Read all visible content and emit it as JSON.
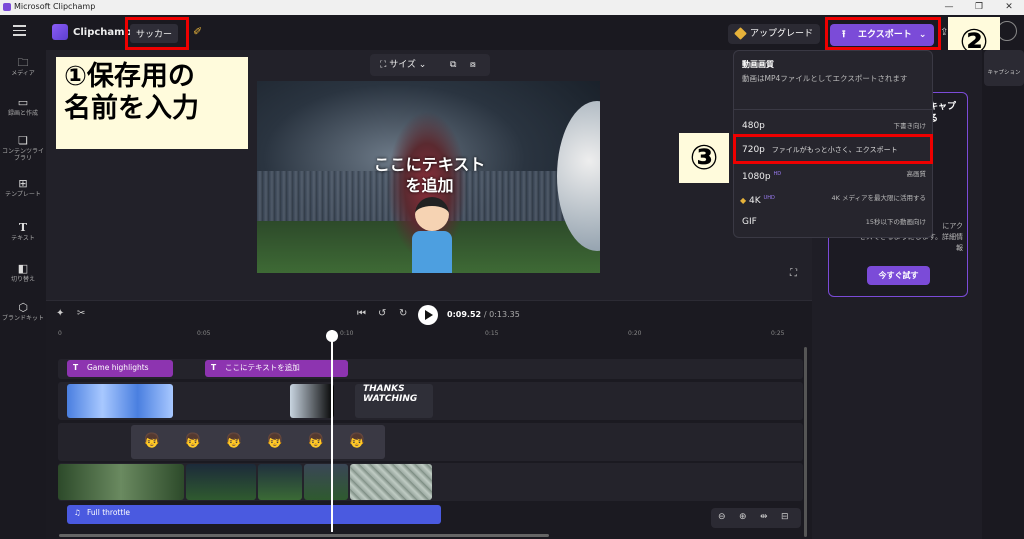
{
  "window": {
    "title": "Microsoft Clipchamp",
    "minimize": "—",
    "maximize": "❐",
    "close": "✕"
  },
  "header": {
    "brand": "Clipchamp",
    "project_name": "サッカー",
    "upgrade_label": "アップグレード",
    "export_label": "エクスポート",
    "export_chevron": "⌄"
  },
  "rail": {
    "items": [
      {
        "icon": "🗀",
        "label": "メディア"
      },
      {
        "icon": "▭",
        "label": "録画と作成"
      },
      {
        "icon": "❏",
        "label": "コンテンツライブラリ"
      },
      {
        "icon": "⊞",
        "label": "テンプレート"
      },
      {
        "icon": "T",
        "label": "テキスト"
      },
      {
        "icon": "◧",
        "label": "切り替え"
      },
      {
        "icon": "⬡",
        "label": "ブランドキット"
      }
    ]
  },
  "preview": {
    "size_label": "サイズ",
    "overlay_text_line1": "ここにテキスト",
    "overlay_text_line2": "を追加"
  },
  "annotations": {
    "note_line1": "①保存用の",
    "note_line2": "名前を入力",
    "step2": "②",
    "step3": "③"
  },
  "export_menu": {
    "heading": "動画画質",
    "description": "動画はMP4ファイルとしてエクスポートされます",
    "options": [
      {
        "label": "480p",
        "desc": "下書き向け",
        "badge": ""
      },
      {
        "label": "720p",
        "desc": "ファイルがもっと小さく、エクスポート",
        "badge": ""
      },
      {
        "label": "1080p",
        "desc": "高画質",
        "badge": "HD"
      },
      {
        "label": "4K",
        "desc": "4K メディアを最大限に活用する",
        "badge": "UHD"
      },
      {
        "label": "GIF",
        "desc": "15秒以下の動画向け",
        "badge": ""
      }
    ]
  },
  "promo": {
    "title_partial": "キャプ\nる",
    "text_partial": "にアク\nセスできるようにします。詳細情\n報",
    "button": "今すぐ試す"
  },
  "right_rail": {
    "caption_label": "キャプション"
  },
  "timeline": {
    "current_time": "0:09.52",
    "total_time": "/ 0:13.35",
    "ruler": [
      "0",
      "0:05",
      "0:10",
      "0:15",
      "0:20",
      "0:25"
    ],
    "text_clips": [
      "Game highlights",
      "ここにテキストを追加"
    ],
    "audio_clip": "Full throttle",
    "thanks_text": "THANKS\nWATCHING"
  }
}
